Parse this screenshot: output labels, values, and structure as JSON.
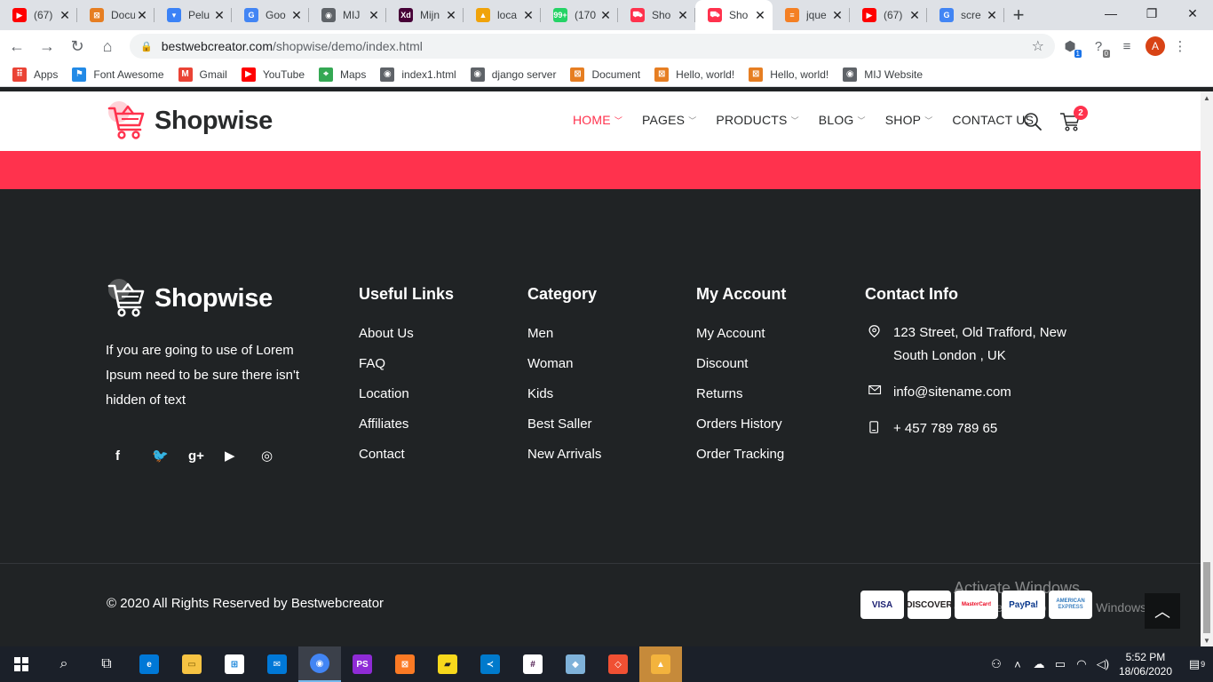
{
  "browser": {
    "tabs": [
      {
        "title": "(67)",
        "favicon_color": "#ff0000",
        "favicon_glyph": "▶"
      },
      {
        "title": "Docu",
        "favicon_color": "#e67e22",
        "favicon_glyph": "⊠"
      },
      {
        "title": "Pelu",
        "favicon_color": "#3b82f6",
        "favicon_glyph": "▾"
      },
      {
        "title": "Goo",
        "favicon_color": "#4285f4",
        "favicon_glyph": "G"
      },
      {
        "title": "MIJ",
        "favicon_color": "#5f6368",
        "favicon_glyph": "◉"
      },
      {
        "title": "Mijn",
        "favicon_color": "#470137",
        "favicon_glyph": "Xd"
      },
      {
        "title": "loca",
        "favicon_color": "#f0a30a",
        "favicon_glyph": "▲"
      },
      {
        "title": "(170",
        "favicon_color": "#25d366",
        "favicon_glyph": "99+"
      },
      {
        "title": "Sho",
        "favicon_color": "#ff324d",
        "favicon_glyph": "⛟"
      },
      {
        "title": "Sho",
        "favicon_color": "#ff324d",
        "favicon_glyph": "⛟",
        "active": true
      },
      {
        "title": "jque",
        "favicon_color": "#f48024",
        "favicon_glyph": "≡"
      },
      {
        "title": "(67)",
        "favicon_color": "#ff0000",
        "favicon_glyph": "▶"
      },
      {
        "title": "scre",
        "favicon_color": "#4285f4",
        "favicon_glyph": "G"
      }
    ],
    "close_glyph": "✕",
    "new_tab_glyph": "+",
    "url_host": "bestwebcreator.com",
    "url_path": "/shopwise/demo/index.html",
    "profile_initial": "A",
    "ext_badge_1": "1",
    "ext_badge_2": "0",
    "bookmarks": [
      {
        "label": "Apps",
        "icon": "apps-icon",
        "color": "#ea4335",
        "glyph": "⠿"
      },
      {
        "label": "Font Awesome",
        "icon": "flag-icon",
        "color": "#228ae6",
        "glyph": "⚑"
      },
      {
        "label": "Gmail",
        "icon": "gmail-icon",
        "color": "#ea4335",
        "glyph": "M"
      },
      {
        "label": "YouTube",
        "icon": "youtube-icon",
        "color": "#ff0000",
        "glyph": "▶"
      },
      {
        "label": "Maps",
        "icon": "maps-icon",
        "color": "#34a853",
        "glyph": "⌖"
      },
      {
        "label": "index1.html",
        "icon": "globe-icon",
        "color": "#5f6368",
        "glyph": "◉"
      },
      {
        "label": "django server",
        "icon": "globe-icon",
        "color": "#5f6368",
        "glyph": "◉"
      },
      {
        "label": "Document",
        "icon": "xampp-icon",
        "color": "#e67e22",
        "glyph": "⊠"
      },
      {
        "label": "Hello, world!",
        "icon": "xampp-icon",
        "color": "#e67e22",
        "glyph": "⊠"
      },
      {
        "label": "Hello, world!",
        "icon": "xampp-icon",
        "color": "#e67e22",
        "glyph": "⊠"
      },
      {
        "label": "MIJ Website",
        "icon": "globe-icon",
        "color": "#5f6368",
        "glyph": "◉"
      }
    ]
  },
  "site": {
    "brand": "Shopwise",
    "accent": "#ff324d",
    "nav": [
      {
        "label": "HOME",
        "active": true
      },
      {
        "label": "PAGES"
      },
      {
        "label": "PRODUCTS"
      },
      {
        "label": "BLOG"
      },
      {
        "label": "SHOP"
      },
      {
        "label": "CONTACT US"
      }
    ],
    "caret_glyph": "﹀",
    "cart_count": "2"
  },
  "footer": {
    "brand": "Shopwise",
    "about": "If you are going to use of Lorem Ipsum need to be sure there isn't hidden of text",
    "social": [
      {
        "name": "facebook-icon",
        "glyph": "f"
      },
      {
        "name": "twitter-icon",
        "glyph": "🐦"
      },
      {
        "name": "google-plus-icon",
        "glyph": "g+"
      },
      {
        "name": "youtube-icon",
        "glyph": "▶"
      },
      {
        "name": "instagram-icon",
        "glyph": "◎"
      }
    ],
    "columns": [
      {
        "title": "Useful Links",
        "links": [
          "About Us",
          "FAQ",
          "Location",
          "Affiliates",
          "Contact"
        ]
      },
      {
        "title": "Category",
        "links": [
          "Men",
          "Woman",
          "Kids",
          "Best Saller",
          "New Arrivals"
        ]
      },
      {
        "title": "My Account",
        "links": [
          "My Account",
          "Discount",
          "Returns",
          "Orders History",
          "Order Tracking"
        ]
      }
    ],
    "contact": {
      "title": "Contact Info",
      "address": "123 Street, Old Trafford, New South London , UK",
      "email": "info@sitename.com",
      "phone": "+ 457 789 789 65"
    },
    "copyright": "© 2020 All Rights Reserved by Bestwebcreator",
    "payments": [
      {
        "label": "VISA",
        "color": "#1a1f71"
      },
      {
        "label": "DISCOVER",
        "color": "#231f20"
      },
      {
        "label": "MasterCard",
        "color": "#eb001b"
      },
      {
        "label": "PayPal",
        "color": "#003087"
      },
      {
        "label": "AMERICAN EXPRESS",
        "color": "#2e77bc"
      }
    ],
    "scroll_top_glyph": "︿"
  },
  "windows": {
    "watermark_title": "Activate Windows",
    "watermark_sub": "Go to Settings to activate Windows.",
    "time": "5:52 PM",
    "date": "18/06/2020",
    "notification_count": "9"
  }
}
